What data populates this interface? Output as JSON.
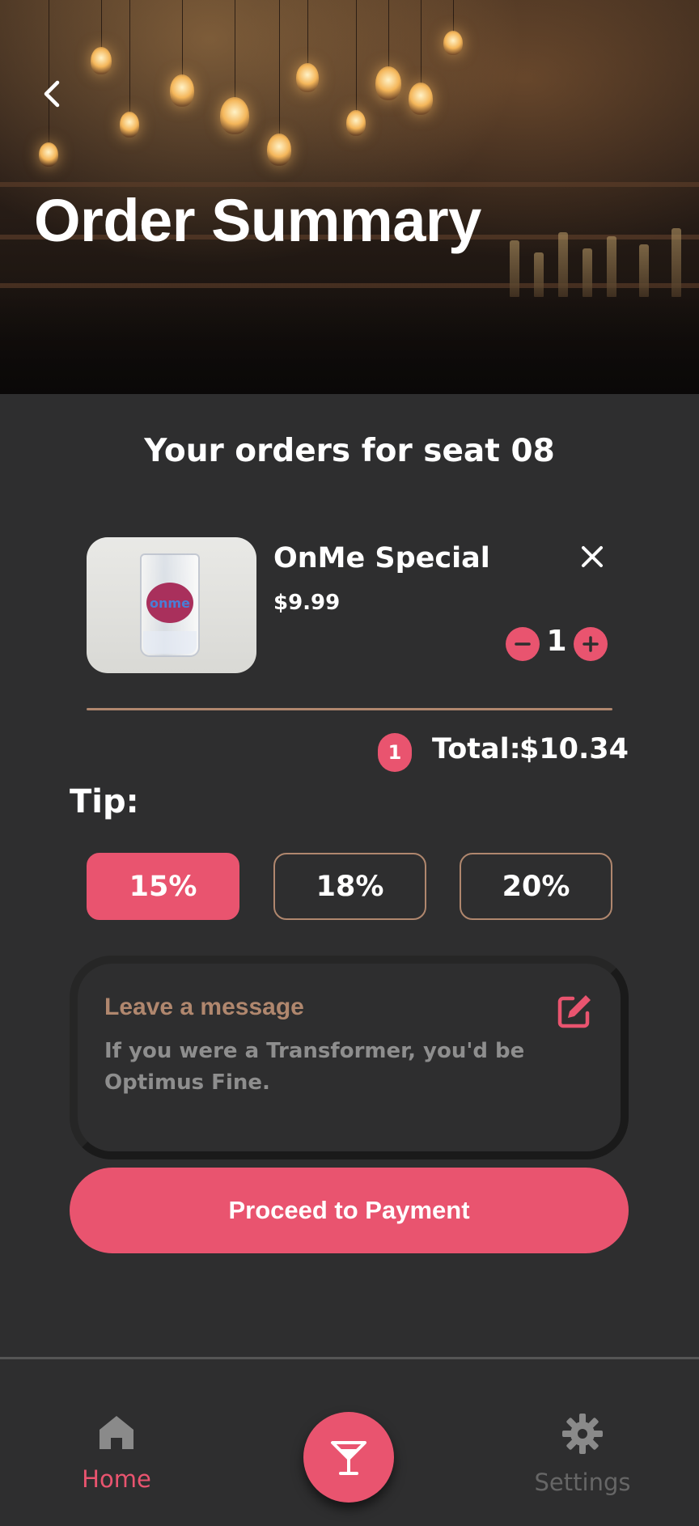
{
  "header": {
    "title": "Order Summary",
    "back_icon": "chevron-left-icon"
  },
  "order": {
    "heading": "Your orders for seat 08",
    "items": [
      {
        "name": "OnMe Special",
        "price": "$9.99",
        "quantity": "1",
        "image_label": "onme"
      }
    ],
    "item_count": "1",
    "total_label": "Total:",
    "total_value": "$10.34"
  },
  "tip": {
    "label": "Tip:",
    "options": [
      "15%",
      "18%",
      "20%"
    ],
    "selected": "15%"
  },
  "message": {
    "title": "Leave a message",
    "body": "If you were a Transformer, you'd be Optimus Fine."
  },
  "actions": {
    "pay_label": "Proceed to Payment"
  },
  "nav": {
    "home_label": "Home",
    "settings_label": "Settings"
  },
  "colors": {
    "accent": "#e9546f",
    "background": "#2e2e2f",
    "divider": "#b0876e"
  }
}
